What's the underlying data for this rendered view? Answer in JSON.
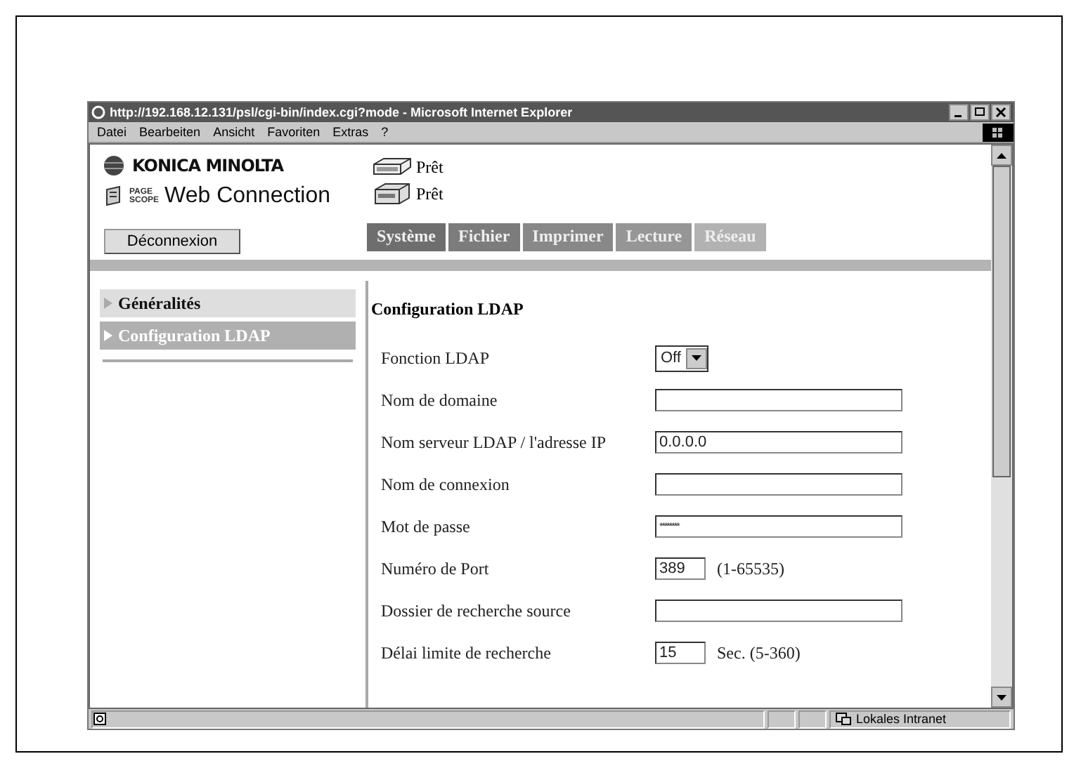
{
  "window": {
    "title": "http://192.168.12.131/psl/cgi-bin/index.cgi?mode - Microsoft Internet Explorer"
  },
  "menu": [
    "Datei",
    "Bearbeiten",
    "Ansicht",
    "Favoriten",
    "Extras",
    "?"
  ],
  "brand": {
    "company": "KONICA MINOLTA",
    "mark_lines": [
      "PAGE",
      "SCOPE"
    ],
    "product": "Web Connection"
  },
  "device_status": [
    {
      "kind": "scanner",
      "label": "Prêt"
    },
    {
      "kind": "printer",
      "label": "Prêt"
    }
  ],
  "logout_button": "Déconnexion",
  "tabs": [
    {
      "label": "Système",
      "color": "#6e6e6e"
    },
    {
      "label": "Fichier",
      "color": "#7c7c7c"
    },
    {
      "label": "Imprimer",
      "color": "#888888"
    },
    {
      "label": "Lecture",
      "color": "#969696"
    },
    {
      "label": "Réseau",
      "color": "#b2b2b2"
    }
  ],
  "sidebar": {
    "items": [
      {
        "label": "Généralités",
        "selected": false
      },
      {
        "label": "Configuration LDAP",
        "selected": true
      }
    ]
  },
  "heading": "Configuration LDAP",
  "fields": [
    {
      "label": "Fonction LDAP",
      "kind": "select",
      "value": "Off"
    },
    {
      "label": "Nom de domaine",
      "kind": "text"
    },
    {
      "label": "Nom serveur LDAP / l'adresse IP",
      "kind": "text",
      "value": "0.0.0.0"
    },
    {
      "label": "Nom de connexion",
      "kind": "text"
    },
    {
      "label": "Mot de passe",
      "kind": "password",
      "value": "********"
    },
    {
      "label": "Numéro de Port",
      "kind": "short",
      "value": "389",
      "hint": "(1-65535)"
    },
    {
      "label": "Dossier de recherche source",
      "kind": "text"
    },
    {
      "label": "Délai limite de recherche",
      "kind": "short",
      "value": "15",
      "hint": "Sec. (5-360)"
    }
  ],
  "status_bar": {
    "zone": "Lokales Intranet"
  }
}
